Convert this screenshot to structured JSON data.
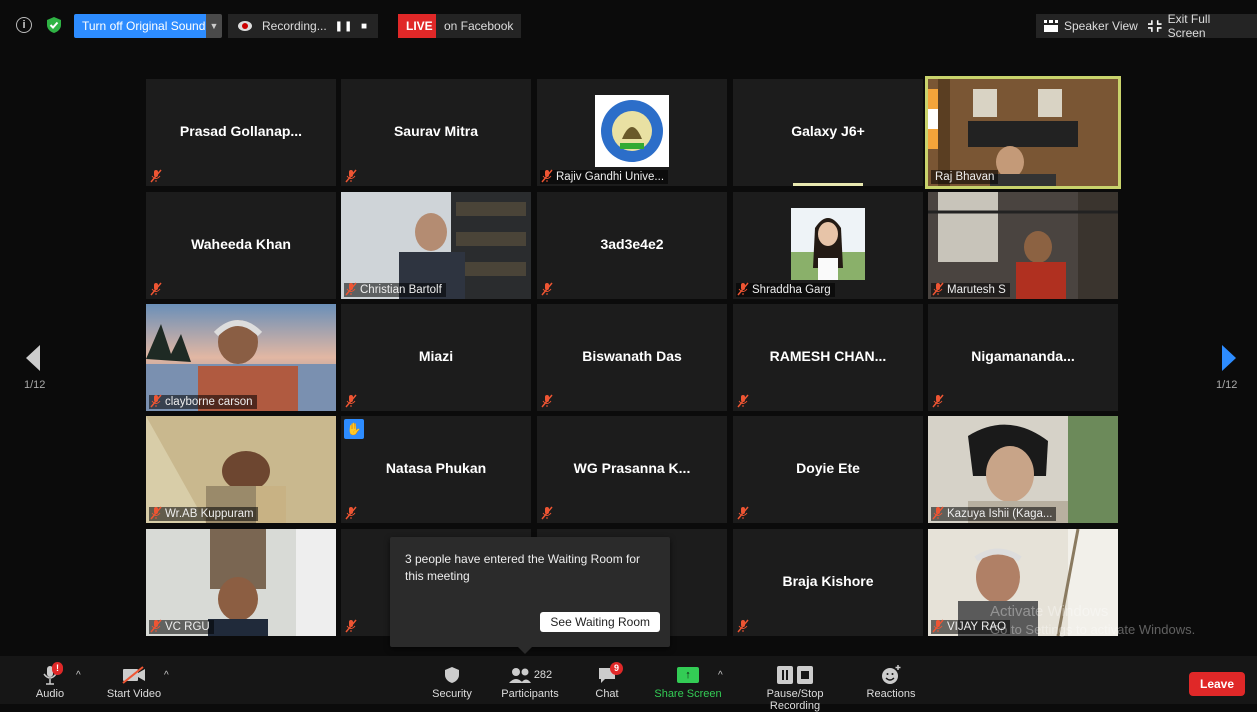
{
  "topbar": {
    "sound_label": "Turn off Original Sound",
    "recording_label": "Recording...",
    "live_label": "LIVE",
    "facebook_label": "on Facebook",
    "speaker_view_label": "Speaker View",
    "exit_fullscreen_label": "Exit Full Screen"
  },
  "pagination": {
    "left_page": "1/12",
    "right_page": "1/12"
  },
  "tiles": [
    {
      "name": "Prasad  Gollanap..."
    },
    {
      "name": "Saurav Mitra"
    },
    {
      "label": "Rajiv Gandhi Unive..."
    },
    {
      "name": "Galaxy J6+"
    },
    {
      "label": "Raj Bhavan"
    },
    {
      "name": "Waheeda Khan"
    },
    {
      "label": "Christian Bartolf"
    },
    {
      "name": "3ad3e4e2"
    },
    {
      "label": "Shraddha Garg"
    },
    {
      "label": "Marutesh S"
    },
    {
      "label": "clayborne carson"
    },
    {
      "name": "Miazi"
    },
    {
      "name": "Biswanath Das"
    },
    {
      "name": "RAMESH  CHAN..."
    },
    {
      "name": "Nigamananda..."
    },
    {
      "label": "Wr.AB Kuppuram"
    },
    {
      "name": "Natasa Phukan"
    },
    {
      "name": "WG  Prasanna  K..."
    },
    {
      "name": "Doyie Ete"
    },
    {
      "label": "Kazuya Ishii (Kaga..."
    },
    {
      "label": "VC  RGU"
    },
    {
      "name": ""
    },
    {
      "name": ""
    },
    {
      "name": "Braja Kishore"
    },
    {
      "label": "VIJAY RAO"
    }
  ],
  "waiting_room": {
    "message": "3 people have entered the Waiting Room for this meeting",
    "button_label": "See Waiting Room"
  },
  "watermark": {
    "line1": "Activate Windows",
    "line2": "Go to Settings to activate Windows."
  },
  "bottombar": {
    "audio_label": "Audio",
    "video_label": "Start Video",
    "security_label": "Security",
    "participants_label": "Participants",
    "participants_count": "282",
    "chat_label": "Chat",
    "chat_badge": "9",
    "share_label": "Share Screen",
    "record_label": "Pause/Stop Recording",
    "reactions_label": "Reactions",
    "leave_label": "Leave"
  },
  "colors": {
    "accent": "#2d8cff",
    "live": "#e02828",
    "active_speaker": "#c9d36c",
    "share": "#33cc55"
  }
}
